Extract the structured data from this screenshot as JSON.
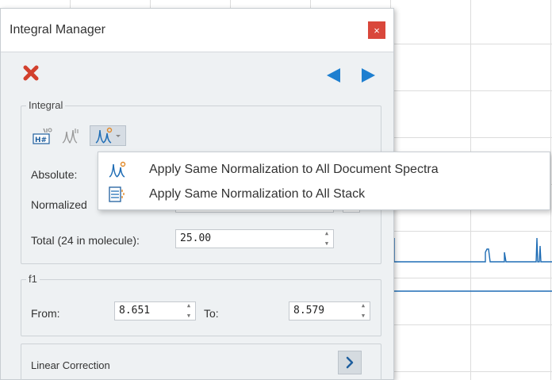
{
  "panel": {
    "title": "Integral Manager",
    "close_glyph": "×"
  },
  "integral": {
    "legend": "Integral",
    "absolute_label": "Absolute:",
    "normalized_label": "Normalized",
    "total_label": "Total (24 in molecule):",
    "total_value": "25.00",
    "icons": [
      "h-number-icon",
      "integral-peaks-icon",
      "normalization-icon"
    ]
  },
  "f1": {
    "legend": "f1",
    "from_label": "From:",
    "from_value": "8.651",
    "to_label": "To:",
    "to_value": "8.579"
  },
  "linear": {
    "label": "Linear Correction",
    "button_glyph": "›"
  },
  "menu": {
    "items": [
      {
        "label": "Apply Same Normalization to All Document Spectra",
        "icon": "spectra-normalize-icon"
      },
      {
        "label": "Apply Same Normalization to All Stack",
        "icon": "stack-normalize-icon"
      }
    ]
  },
  "colors": {
    "accent_blue": "#1e7fd0",
    "close_red": "#d9473b",
    "delete_red": "#d2402d",
    "spectrum_line": "#1f6db5",
    "panel_bg": "#eef1f3"
  }
}
